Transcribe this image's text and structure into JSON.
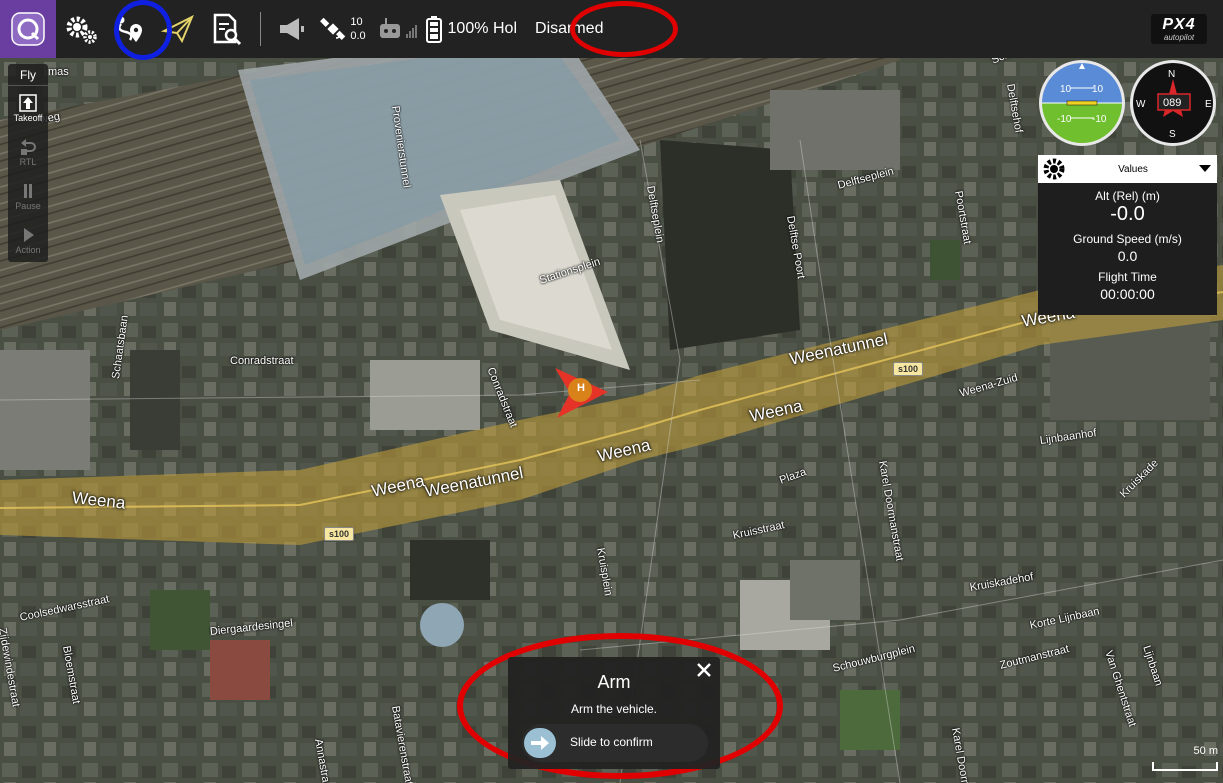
{
  "toolbar": {
    "gps_count": "10",
    "gps_hdop": "0.0",
    "battery_percent": "100%",
    "flight_mode": "Hol",
    "arm_state": "Disarmed",
    "px4_logo_big": "PX4",
    "px4_logo_small": "autopilot"
  },
  "fly_tools": {
    "header": "Fly",
    "items": [
      {
        "label": "Takeoff",
        "enabled": true
      },
      {
        "label": "RTL",
        "enabled": false
      },
      {
        "label": "Pause",
        "enabled": false
      },
      {
        "label": "Action",
        "enabled": false
      }
    ]
  },
  "instruments": {
    "attitude_pitch_labels": [
      "10",
      "-10"
    ],
    "compass_heading": "089",
    "compass_labels": [
      "N",
      "E",
      "S",
      "W"
    ]
  },
  "values_panel": {
    "dropdown_label": "Values",
    "items": [
      {
        "label": "Alt (Rel) (m)",
        "value": "-0.0",
        "large": true
      },
      {
        "label": "Ground Speed (m/s)",
        "value": "0.0",
        "large": false
      },
      {
        "label": "Flight Time",
        "value": "00:00:00",
        "large": false
      }
    ]
  },
  "arm_dialog": {
    "title": "Arm",
    "description": "Arm the vehicle.",
    "slider_label": "Slide to confirm"
  },
  "map": {
    "home_marker": "H",
    "scale_label": "50 m",
    "streets": [
      "Weena",
      "Weenatunnel",
      "Weena",
      "Weena",
      "Weenatunnel",
      "Weena-Zuid",
      "Weena",
      "Conradstraat",
      "Stationsplein",
      "Delftseplein",
      "Delftseplein",
      "Delftse Poort",
      "Poortstraat",
      "Provenierstunnel",
      "Schiestraat",
      "Delftsehof",
      "Conradstraat",
      "Schaatsbaan",
      "Lijnbaanhof",
      "Kruiskade",
      "Plaza",
      "Kruisstraat",
      "Kruisplein",
      "Karel Doormanstraat",
      "Kruiskadehof",
      "Korte Lijnbaan",
      "Zoutmanstraat",
      "Van Ghentstraat",
      "Lijnbaan",
      "Schouwburgplein",
      "Diergaardesingel",
      "Coolsedwarsstraat",
      "Bloemstraat",
      "Zijdewindestraat",
      "Batavierenstraat",
      "Annastraat",
      "Karel Doorman",
      "weg",
      "mas"
    ],
    "road_shield": "s100"
  },
  "colors": {
    "toolbar_bg": "#222222",
    "logo_bg": "#6a3ea0",
    "annotation_red": "#e00000",
    "annotation_blue": "#1020e0",
    "road_overlay": "#c8a43a"
  }
}
